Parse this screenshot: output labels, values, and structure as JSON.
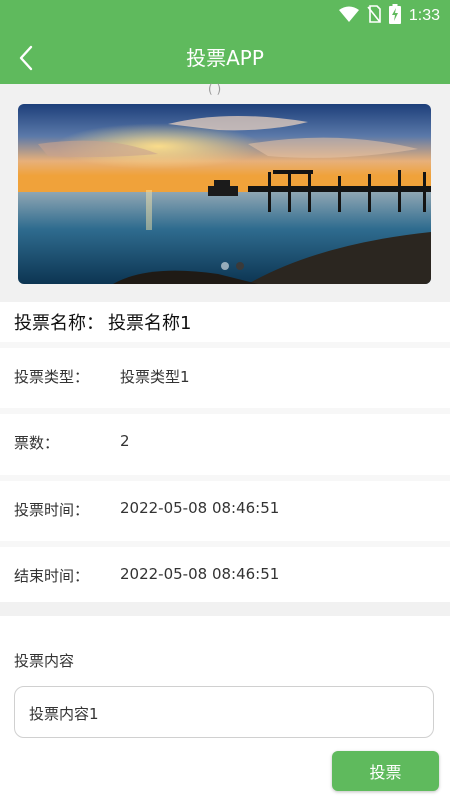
{
  "status_bar": {
    "time": "1:33",
    "icons": [
      "wifi-icon",
      "no-sim-icon",
      "battery-charging-icon"
    ]
  },
  "app_bar": {
    "title": "投票APP",
    "back_icon": "chevron-left-icon"
  },
  "colors": {
    "primary": "#5fba5d",
    "background_gray": "#f1f1f1"
  },
  "carousel": {
    "image": "sunset-pier-photo",
    "pages": 2,
    "active_page": 2
  },
  "vote": {
    "name_label": "投票名称：",
    "name_value": "投票名称1",
    "fields": [
      {
        "label": "投票类型：",
        "value": "投票类型1"
      },
      {
        "label": "票数：",
        "value": "2"
      },
      {
        "label": "投票时间：",
        "value": "2022-05-08 08:46:51"
      },
      {
        "label": "结束时间：",
        "value": "2022-05-08 08:46:51"
      }
    ],
    "content_label": "投票内容",
    "content_value": "投票内容1",
    "submit_label": "投票"
  }
}
